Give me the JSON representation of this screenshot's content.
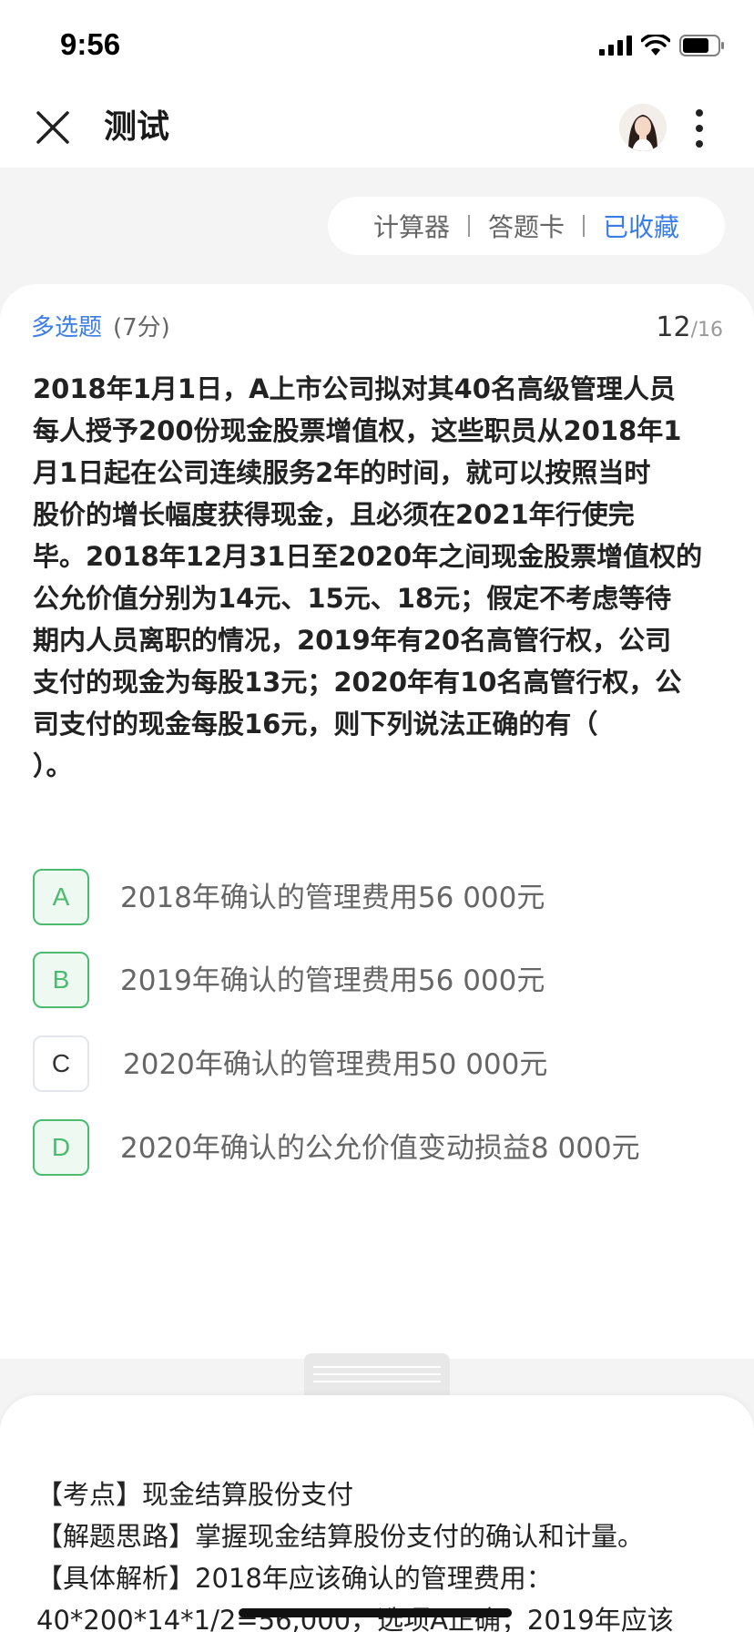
{
  "status_bar": {
    "time": "9:56"
  },
  "nav": {
    "title": "测试"
  },
  "tools": {
    "calculator": "计算器",
    "answer_card": "答题卡",
    "favorite": "已收藏"
  },
  "question": {
    "type_label": "多选题",
    "score": "(7分)",
    "current": "12",
    "total": "/16",
    "stem_lines": [
      "2018年1月1日，A上市公司拟对其40名高级管理人员",
      "每人授予200份现金股票增值权，这些职员从2018年1",
      "月1日起在公司连续服务2年的时间，就可以按照当时",
      "股价的增长幅度获得现金，且必须在2021年行使完",
      "毕。2018年12月31日至2020年之间现金股票增值权的",
      "公允价值分别为14元、15元、18元；假定不考虑等待",
      "期内人员离职的情况，2019年有20名高管行权，公司",
      "支付的现金为每股13元；2020年有10名高管行权，公",
      "司支付的现金每股16元，则下列说法正确的有（",
      "）。"
    ],
    "options": [
      {
        "letter": "A",
        "text": "2018年确认的管理费用56 000元",
        "selected": true
      },
      {
        "letter": "B",
        "text": "2019年确认的管理费用56 000元",
        "selected": true
      },
      {
        "letter": "C",
        "text": "2020年确认的管理费用50 000元",
        "selected": false
      },
      {
        "letter": "D",
        "text": "2020年确认的公允价值变动损益8 000元",
        "selected": true
      }
    ]
  },
  "analysis": {
    "lines": [
      "【考点】现金结算股份支付",
      "【解题思路】掌握现金结算股份支付的确认和计量。",
      "【具体解析】2018年应该确认的管理费用：",
      "40*200*14*1/2=56,000，选项A正确；2019年应该"
    ]
  },
  "colors": {
    "accent": "#3b7de8",
    "selected_green": "#4cba6f",
    "page_bg": "#f4f4f5"
  }
}
